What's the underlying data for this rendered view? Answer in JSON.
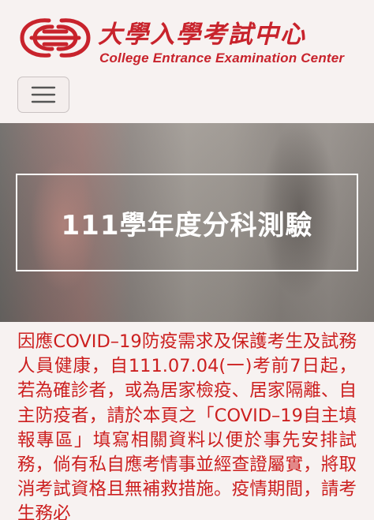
{
  "header": {
    "logo_cn": "大學入學考試中心",
    "logo_en": "College Entrance Examination Center",
    "brand_color": "#c8232c",
    "menu_icon": "hamburger-menu-icon"
  },
  "hero": {
    "title": "111學年度分科測驗"
  },
  "notice": {
    "text": "因應COVID–19防疫需求及保護考生及試務人員健康，自111.07.04(一)考前7日起，若為確診者，或為居家檢疫、居家隔離、自主防疫者，請於本頁之「COVID–19自主填報專區」填寫相關資料以便於事先安排試務，倘有私自應考情事並經查證屬實，將取消考試資格且無補救措施。疫情期間，請考生務必",
    "color": "#cc1f1f"
  }
}
